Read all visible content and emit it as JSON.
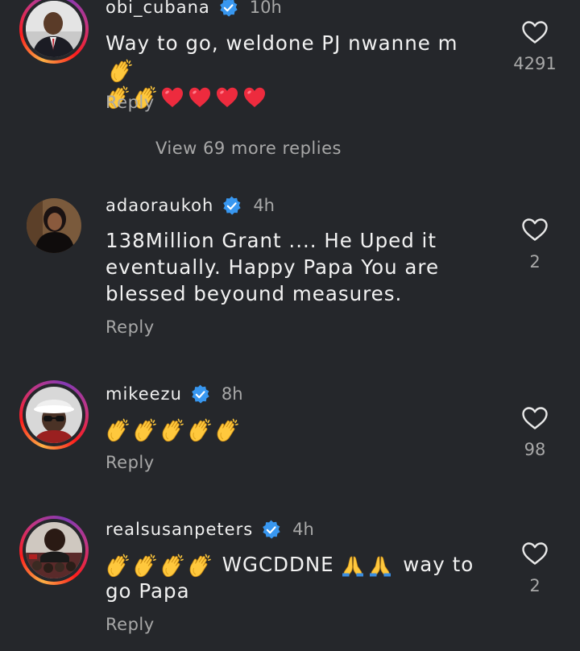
{
  "comments": [
    {
      "username": "obi_cubana",
      "time": "10h",
      "text": "Way to go, weldone PJ nwanne m",
      "emoji_line": "👋👋❤️❤️❤️❤️",
      "likes": "4291",
      "reply_label": "Reply",
      "view_more": "View 69 more replies",
      "story_ring": true
    },
    {
      "username": "adaoraukoh",
      "time": "4h",
      "text": "138Million Grant .... He Uped it eventually.  Happy Papa You are blessed beyound measures.",
      "likes": "2",
      "reply_label": "Reply",
      "story_ring": false
    },
    {
      "username": "mikeezu",
      "time": "8h",
      "emoji_line": "👏👏👏👏👏",
      "likes": "98",
      "reply_label": "Reply",
      "story_ring": true
    },
    {
      "username": "realsusanpeters",
      "time": "4h",
      "emoji_prefix": "👏👏👏👏",
      "text_a": "WGCDDNE",
      "emoji_mid": "🙏🙏",
      "text_b": "way to",
      "text_c": "go Papa",
      "likes": "2",
      "reply_label": "Reply",
      "story_ring": true
    }
  ],
  "colors": {
    "background": "#25272b",
    "verified_badge": "#3897f0",
    "secondary_text": "#a8a8a8",
    "heart": "#ed2b3e",
    "clap": "#ffc83d"
  },
  "icons": [
    "verified-badge-icon",
    "heart-outline-icon",
    "clapping-hands-emoji",
    "red-heart-emoji",
    "folded-hands-emoji"
  ]
}
